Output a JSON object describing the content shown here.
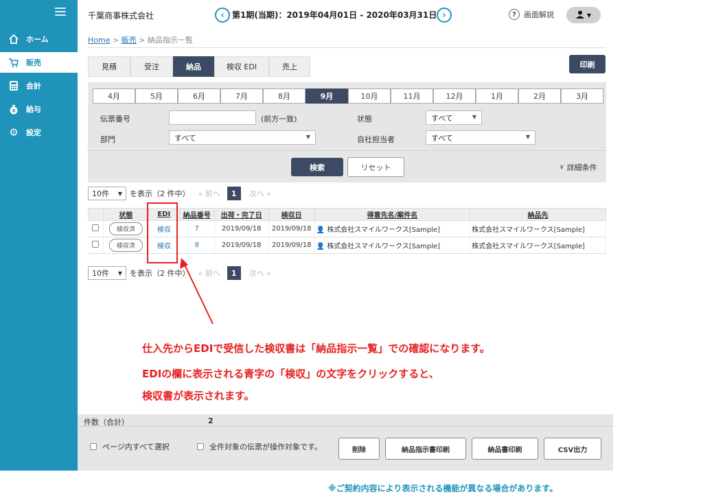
{
  "sidebar": {
    "items": [
      {
        "label": "ホーム",
        "icon": "home-icon"
      },
      {
        "label": "販売",
        "icon": "cart-icon"
      },
      {
        "label": "会計",
        "icon": "calculator-icon"
      },
      {
        "label": "給与",
        "icon": "money-bag-icon"
      },
      {
        "label": "設定",
        "icon": "gear-icon"
      }
    ],
    "active": "販売"
  },
  "header": {
    "company": "千葉商事株式会社",
    "period": "第1期(当期)：2019年04月01日 - 2020年03月31日",
    "prev": "‹",
    "next": "›",
    "help": "画面解説"
  },
  "breadcrumb": {
    "home": "Home",
    "sales": "販売",
    "current": "納品指示一覧"
  },
  "tabs": [
    {
      "label": "見積"
    },
    {
      "label": "受注"
    },
    {
      "label": "納品",
      "active": true
    },
    {
      "label": "検収 EDI"
    },
    {
      "label": "売上"
    }
  ],
  "print_label": "印刷",
  "months": [
    "4月",
    "5月",
    "6月",
    "7月",
    "8月",
    "9月",
    "10月",
    "11月",
    "12月",
    "1月",
    "2月",
    "3月"
  ],
  "active_month": "9月",
  "filter": {
    "slip_label": "伝票番号",
    "slip_value": "",
    "slip_hint": "(前方一致)",
    "status_label": "状態",
    "status_value": "すべて",
    "dept_label": "部門",
    "dept_value": "すべて",
    "staff_label": "自社担当者",
    "staff_value": "すべて",
    "search": "検索",
    "reset": "リセット",
    "advanced": "詳細条件"
  },
  "pager": {
    "per_page": "10件",
    "showing": "を表示（2 件中）",
    "prev": "« 前へ",
    "page": "1",
    "next": "次へ »"
  },
  "table": {
    "headers": [
      "状態",
      "EDI",
      "納品番号",
      "出荷・完了日",
      "検収日",
      "得意先名/案件名",
      "納品先"
    ],
    "rows": [
      {
        "status": "検収済",
        "edi": "検収",
        "no": "7",
        "ship": "2019/09/18",
        "inspect": "2019/09/18",
        "customer": "株式会社スマイルワークス[Sample]",
        "dest": "株式会社スマイルワークス[Sample]"
      },
      {
        "status": "検収済",
        "edi": "検収",
        "no": "8",
        "ship": "2019/09/18",
        "inspect": "2019/09/18",
        "customer": "株式会社スマイルワークス[Sample]",
        "dest": "株式会社スマイルワークス[Sample]"
      }
    ]
  },
  "callout": {
    "line1": "仕入先からEDIで受信した検収書は「納品指示一覧」での確認になります。",
    "line2": "EDIの欄に表示される青字の「検収」の文字をクリックすると、",
    "line3": "検収書が表示されます。"
  },
  "summary": {
    "count_label": "件数（合計）",
    "count": "2"
  },
  "footer": {
    "select_page": "ページ内すべて選択",
    "select_all": "全件対象の伝票が操作対象です。",
    "buttons": [
      "削除",
      "納品指示書印刷",
      "納品書印刷",
      "CSV出力"
    ]
  },
  "note": "※ご契約内容により表示される機能が異なる場合があります。",
  "colors": {
    "sidebar": "#1f93ba",
    "dark": "#3d4a63",
    "annotation": "#e62020",
    "link": "#2a73b5"
  }
}
